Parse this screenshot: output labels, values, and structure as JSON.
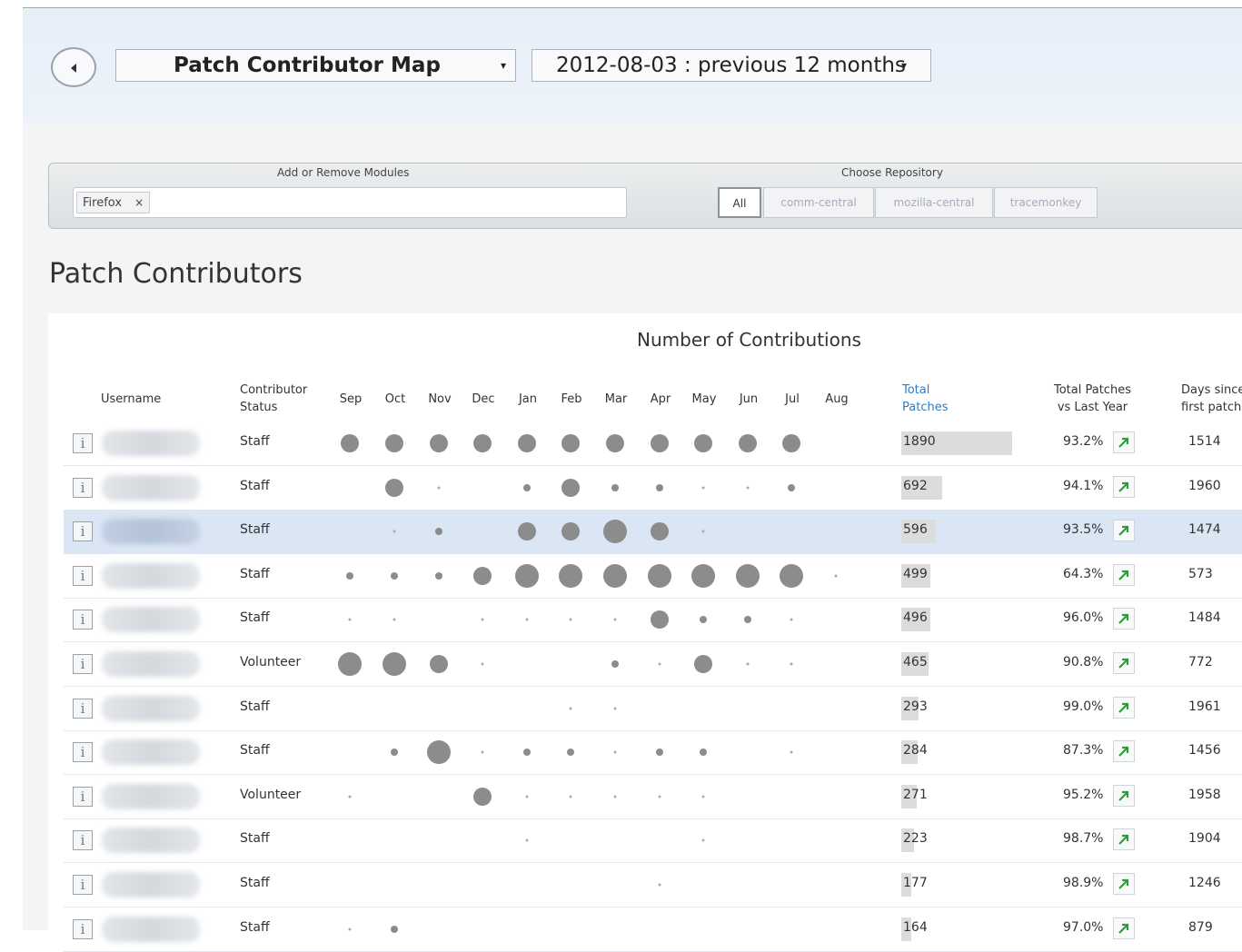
{
  "toolbar": {
    "report_select": "Patch Contributor Map",
    "date_select": "2012-08-03 : previous 12 months"
  },
  "filters": {
    "modules_label": "Add or Remove Modules",
    "module_chip": "Firefox",
    "repo_label": "Choose Repository",
    "repos": [
      "All",
      "comm-central",
      "mozilla-central",
      "tracemonkey"
    ],
    "active_repo": "All"
  },
  "page": {
    "title": "Patch Contributors"
  },
  "table": {
    "group_header": "Number of Contributions",
    "headers": {
      "username": "Username",
      "status": [
        "Contributor",
        "Status"
      ],
      "months": [
        "Sep",
        "Oct",
        "Nov",
        "Dec",
        "Jan",
        "Feb",
        "Mar",
        "Apr",
        "May",
        "Jun",
        "Jul",
        "Aug"
      ],
      "total": [
        "Total",
        "Patches"
      ],
      "vs_last_year": [
        "Total Patches",
        "vs Last Year"
      ],
      "days_since": [
        "Days since",
        "first patch"
      ]
    },
    "rows": [
      {
        "status": "Staff",
        "total": "1890",
        "pct": "93.2%",
        "days": "1514",
        "dots": [
          3,
          3,
          3,
          3,
          3,
          3,
          3,
          3,
          3,
          3,
          3,
          0
        ]
      },
      {
        "status": "Staff",
        "total": "692",
        "pct": "94.1%",
        "days": "1960",
        "dots": [
          0,
          3,
          1,
          0,
          2,
          3,
          2,
          2,
          1,
          1,
          2,
          0
        ]
      },
      {
        "status": "Staff",
        "total": "596",
        "pct": "93.5%",
        "days": "1474",
        "dots": [
          0,
          1,
          2,
          0,
          3,
          3,
          4,
          3,
          1,
          0,
          0,
          0
        ],
        "selected": true
      },
      {
        "status": "Staff",
        "total": "499",
        "pct": "64.3%",
        "days": "573",
        "dots": [
          2,
          2,
          2,
          3,
          4,
          4,
          4,
          4,
          4,
          4,
          4,
          1
        ]
      },
      {
        "status": "Staff",
        "total": "496",
        "pct": "96.0%",
        "days": "1484",
        "dots": [
          1,
          1,
          0,
          1,
          1,
          1,
          1,
          3,
          2,
          2,
          1,
          0
        ]
      },
      {
        "status": "Volunteer",
        "total": "465",
        "pct": "90.8%",
        "days": "772",
        "dots": [
          4,
          4,
          3,
          1,
          0,
          0,
          2,
          1,
          3,
          1,
          1,
          0
        ]
      },
      {
        "status": "Staff",
        "total": "293",
        "pct": "99.0%",
        "days": "1961",
        "dots": [
          0,
          0,
          0,
          0,
          0,
          1,
          1,
          0,
          0,
          0,
          0,
          0
        ]
      },
      {
        "status": "Staff",
        "total": "284",
        "pct": "87.3%",
        "days": "1456",
        "dots": [
          0,
          2,
          4,
          1,
          2,
          2,
          1,
          2,
          2,
          0,
          1,
          0
        ]
      },
      {
        "status": "Volunteer",
        "total": "271",
        "pct": "95.2%",
        "days": "1958",
        "dots": [
          1,
          0,
          0,
          3,
          1,
          1,
          1,
          1,
          1,
          0,
          0,
          0
        ]
      },
      {
        "status": "Staff",
        "total": "223",
        "pct": "98.7%",
        "days": "1904",
        "dots": [
          0,
          0,
          0,
          0,
          1,
          0,
          0,
          0,
          1,
          0,
          0,
          0
        ]
      },
      {
        "status": "Staff",
        "total": "177",
        "pct": "98.9%",
        "days": "1246",
        "dots": [
          0,
          0,
          0,
          0,
          0,
          0,
          0,
          1,
          0,
          0,
          0,
          0
        ]
      },
      {
        "status": "Staff",
        "total": "164",
        "pct": "97.0%",
        "days": "879",
        "dots": [
          1,
          2,
          0,
          0,
          0,
          0,
          0,
          0,
          0,
          0,
          0,
          0
        ]
      }
    ]
  },
  "colors": {
    "accent_blue": "#2a7ec9",
    "selected_row": "#dbe6f5",
    "dot": "#8c8c8c",
    "trend_up": "#2e9e3a"
  },
  "icons": [
    "back-arrow-icon",
    "dropdown-caret-icon",
    "remove-chip-icon",
    "info-icon",
    "trend-up-icon"
  ]
}
